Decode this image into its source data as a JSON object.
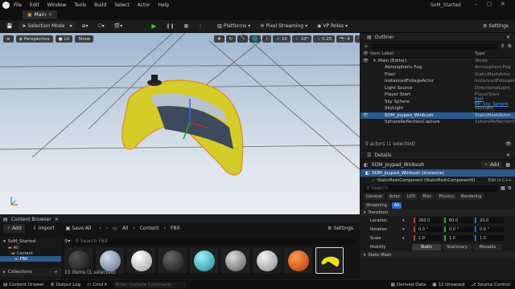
{
  "titlebar": {
    "menu": [
      "File",
      "Edit",
      "Window",
      "Tools",
      "Build",
      "Select",
      "Actor",
      "Help"
    ],
    "project": "SoM_Started"
  },
  "tabbar": {
    "tab": "Main"
  },
  "toolbar": {
    "selection_mode": "Selection Mode",
    "platforms": "Platforms",
    "pixel_streaming": "Pixel Streaming",
    "vp_roles": "VP Roles",
    "settings": "Settings"
  },
  "viewport": {
    "perspective": "Perspective",
    "lit": "Lit",
    "show": "Show",
    "grid_snap": "10",
    "rot_snap": "10°",
    "scale_snap": "0.25",
    "cam_speed": "4"
  },
  "outliner": {
    "title": "Outliner",
    "col_label": "Item Label",
    "col_type": "Type",
    "items": [
      {
        "label": "Main (Editor)",
        "type": "World"
      },
      {
        "label": "Atmospheric Fog",
        "type": "AtmosphericFog"
      },
      {
        "label": "Floor",
        "type": "StaticMeshActor"
      },
      {
        "label": "InstancedFoliageActor",
        "type": "InstancedFoliageActor"
      },
      {
        "label": "Light Source",
        "type": "DirectionalLight"
      },
      {
        "label": "Player Start",
        "type": "PlayerStart"
      },
      {
        "label": "Sky Sphere",
        "type": "Edit BP_Sky_Sphere"
      },
      {
        "label": "SkyLight",
        "type": "SkyLight"
      },
      {
        "label": "SOM_Joypad_Winbush",
        "type": "StaticMeshActor"
      },
      {
        "label": "SphereReflectionCapture",
        "type": "SphereReflectionCapture"
      }
    ],
    "count": "9 actors (1 selected)"
  },
  "details": {
    "title": "Details",
    "actor": "SOM_Joypad_Winbush",
    "add": "Add",
    "instance": "SOM_Joypad_Winbush (Instance)",
    "component": "StaticMeshComponent (StaticMeshComponent0)",
    "component_edit": "Edit in C++",
    "search": "Search",
    "tabs": [
      "General",
      "Actor",
      "LOD",
      "Misc",
      "Physics",
      "Rendering",
      "Streaming",
      "All"
    ],
    "transform": "Transform",
    "location": {
      "label": "Location",
      "x": "260.0",
      "y": "60.0",
      "z": "20.0"
    },
    "rotation": {
      "label": "Rotation",
      "x": "0.0 °",
      "y": "0.0 °",
      "z": "0.0 °"
    },
    "scale": {
      "label": "Scale",
      "x": "1.0",
      "y": "1.0",
      "z": "1.0"
    },
    "mobility": {
      "label": "Mobility",
      "static": "Static",
      "stationary": "Stationary",
      "movable": "Movable"
    },
    "static_mesh": "Static Mesh"
  },
  "content": {
    "title": "Content Browser",
    "add": "Add",
    "import": "Import",
    "save_all": "Save All",
    "path": [
      "All",
      "Content",
      "FBX"
    ],
    "settings": "Settings",
    "project": "SoM_Started",
    "tree": [
      "All",
      "Content",
      "FBX"
    ],
    "collections": "Collections",
    "search": "Search FBX",
    "count": "11 items (1 selected)",
    "thumb_colors": [
      "#2b2b2b",
      "#8fa6c8",
      "#e0e0e0",
      "#3a3a3a",
      "#3fc0d0",
      "#9a9a9a",
      "#c8c8c8",
      "#e05818",
      "#e8e020"
    ]
  },
  "statusbar": {
    "content_drawer": "Content Drawer",
    "output_log": "Output Log",
    "cmd": "Cmd",
    "console": "Enter Console Command",
    "derived": "Derived Data",
    "unsaved": "12 Unsaved",
    "source": "Source Control"
  }
}
